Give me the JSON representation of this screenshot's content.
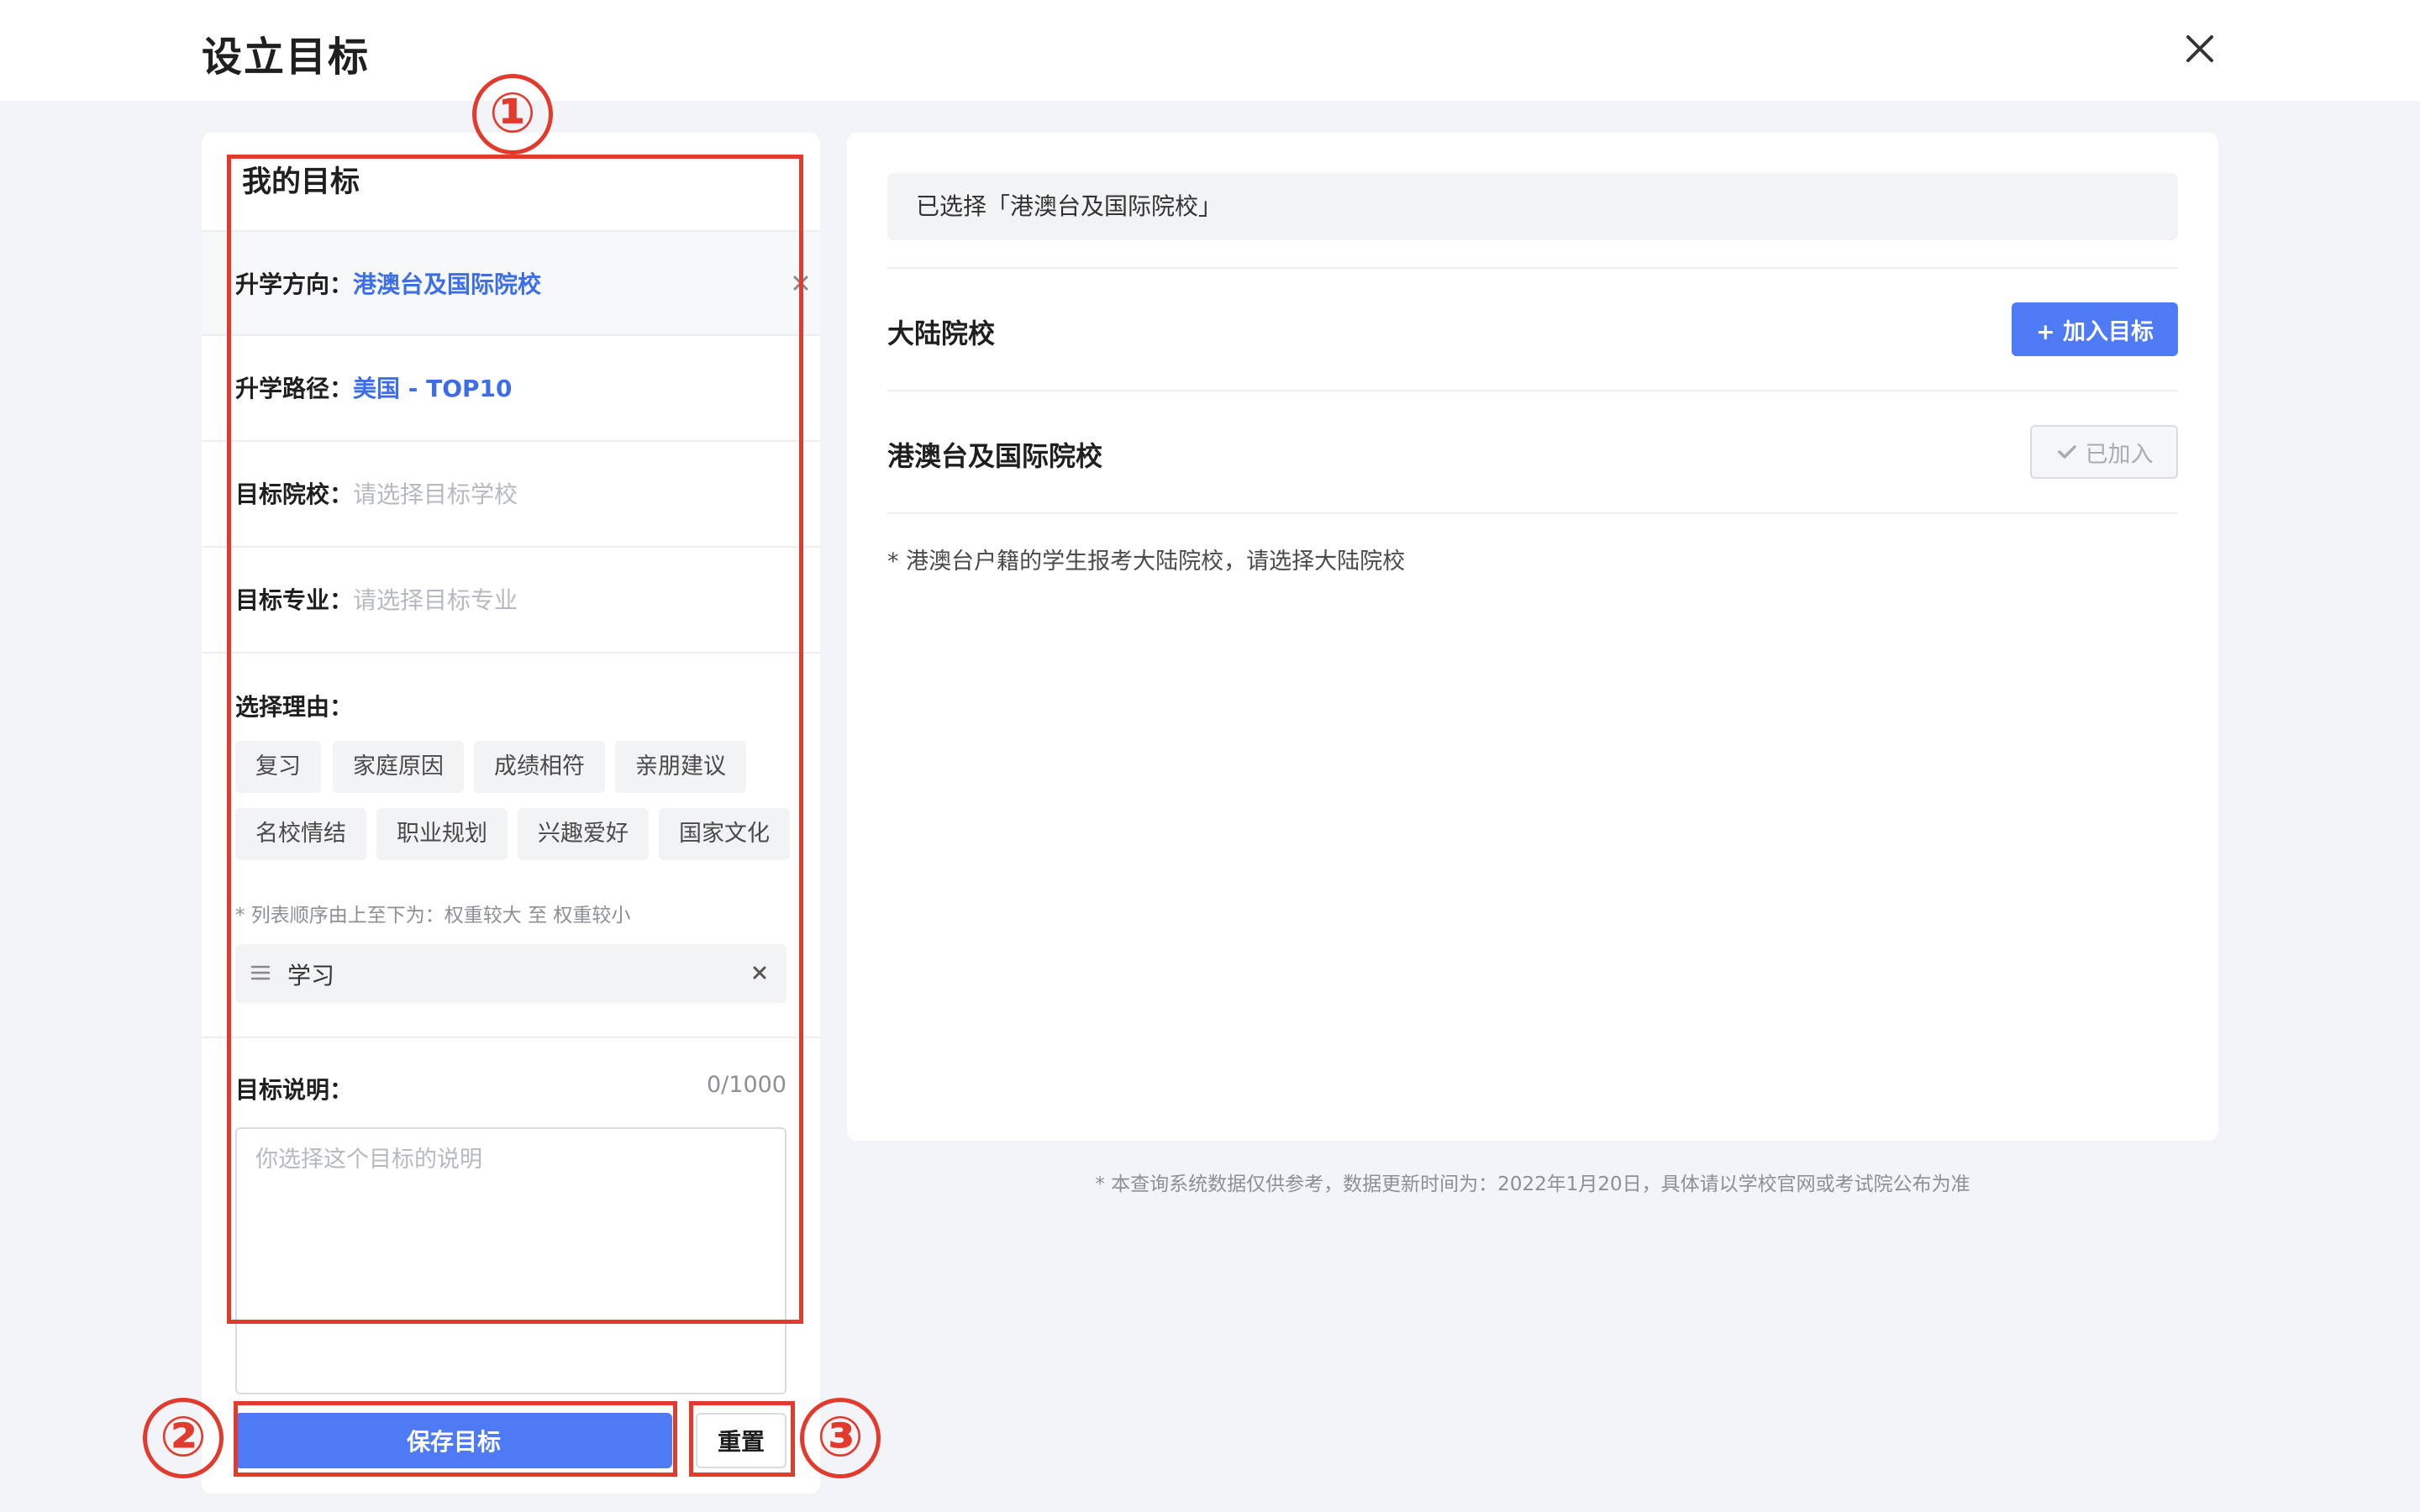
{
  "header": {
    "title": "设立目标",
    "close_icon": "close-icon"
  },
  "left": {
    "title": "我的目标",
    "rows": [
      {
        "label": "升学方向：",
        "value": "港澳台及国际院校",
        "kind": "value"
      },
      {
        "label": "升学路径：",
        "value": "美国 - TOP10",
        "kind": "value"
      },
      {
        "label": "目标院校：",
        "placeholder": "请选择目标学校",
        "kind": "placeholder"
      },
      {
        "label": "目标专业：",
        "placeholder": "请选择目标专业",
        "kind": "placeholder"
      }
    ],
    "reasons_label": "选择理由：",
    "reasons": [
      "复习",
      "家庭原因",
      "成绩相符",
      "亲朋建议",
      "名校情结",
      "职业规划",
      "兴趣爱好",
      "国家文化"
    ],
    "order_note": "* 列表顺序由上至下为：权重较大 至 权重较小",
    "selected_reasons": [
      "学习"
    ],
    "description_label": "目标说明：",
    "description_count": "0/1000",
    "description_placeholder": "你选择这个目标的说明",
    "description_value": "",
    "save_label": "保存目标",
    "reset_label": "重置"
  },
  "right": {
    "selected_text": "已选择「港澳台及国际院校」",
    "categories": [
      {
        "name": "大陆院校",
        "action": "+ 加入目标",
        "state": "add"
      },
      {
        "name": "港澳台及国际院校",
        "action": "已加入",
        "state": "added"
      }
    ],
    "note": "* 港澳台户籍的学生报考大陆院校，请选择大陆院校"
  },
  "footer_note": "* 本查询系统数据仅供参考，数据更新时间为：2022年1月20日，具体请以学校官网或考试院公布为准",
  "annotations": [
    "①",
    "②",
    "③"
  ],
  "colors": {
    "accent": "#4e7bf5",
    "link": "#3b6ee8",
    "annotation": "#e23b2e",
    "background": "#f3f4f7"
  }
}
